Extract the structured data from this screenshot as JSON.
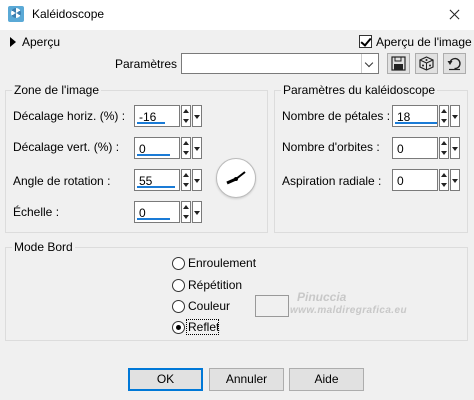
{
  "window": {
    "title": "Kaléidoscope"
  },
  "preview": {
    "toggle_label": "Aperçu",
    "checkbox_label": "Aperçu de l'image",
    "checked": true
  },
  "presets": {
    "label": "Paramètres",
    "value": ""
  },
  "image_zone": {
    "title": "Zone de l'image",
    "horiz_offset": {
      "label": "Décalage horiz. (%) :",
      "value": "-16"
    },
    "vert_offset": {
      "label": "Décalage vert. (%) :",
      "value": "0"
    },
    "rotation": {
      "label": "Angle de rotation :",
      "value": "55"
    },
    "scale": {
      "label": "Échelle :",
      "value": "0"
    }
  },
  "kaleidoscope": {
    "title": "Paramètres du kaléidoscope",
    "petals": {
      "label": "Nombre de pétales :",
      "value": "18"
    },
    "orbits": {
      "label": "Nombre d'orbites :",
      "value": "0"
    },
    "suction": {
      "label": "Aspiration radiale :",
      "value": "0"
    }
  },
  "edge_mode": {
    "title": "Mode Bord",
    "options": [
      "Enroulement",
      "Répétition",
      "Couleur",
      "Reflet"
    ],
    "selected": "Reflet"
  },
  "watermark": {
    "line1": "Pinuccia",
    "line2": "www.maldiregrafica.eu"
  },
  "buttons": {
    "ok": "OK",
    "cancel": "Annuler",
    "help": "Aide"
  }
}
